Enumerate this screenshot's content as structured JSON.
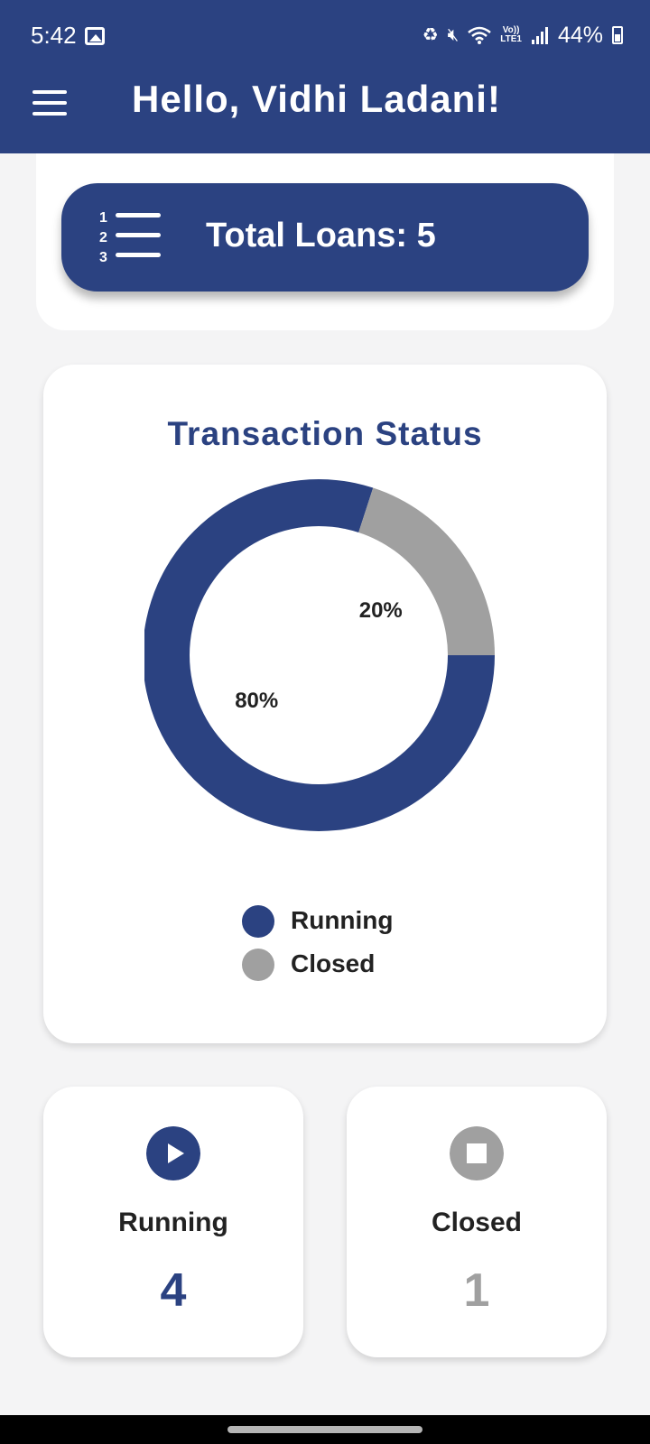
{
  "status_bar": {
    "time": "5:42",
    "network_label_top": "Vo))",
    "network_label_bottom": "LTE1",
    "battery": "44%"
  },
  "header": {
    "title": "Hello, Vidhi Ladani!",
    "menu_icon": "hamburger-menu-icon"
  },
  "loans_summary": {
    "text": "Total Loans: 5",
    "icon": "numbered-list-icon",
    "list_numbers": [
      "1",
      "2",
      "3"
    ]
  },
  "transaction_status": {
    "title": "Transaction Status"
  },
  "chart_data": {
    "type": "pie",
    "variant": "donut",
    "title": "Transaction Status",
    "slices": [
      {
        "name": "Running",
        "value": 80,
        "label": "80%",
        "color": "#2b4281"
      },
      {
        "name": "Closed",
        "value": 20,
        "label": "20%",
        "color": "#a0a0a0"
      }
    ],
    "legend": {
      "placement": "bottom",
      "entries": [
        "Running",
        "Closed"
      ]
    }
  },
  "stats": {
    "running": {
      "label": "Running",
      "value": "4",
      "icon": "play-icon",
      "color": "#2b4281"
    },
    "closed": {
      "label": "Closed",
      "value": "1",
      "icon": "stop-icon",
      "color": "#a0a0a0"
    }
  },
  "colors": {
    "primary": "#2b4281",
    "secondary": "#a0a0a0",
    "background": "#f4f4f5"
  }
}
